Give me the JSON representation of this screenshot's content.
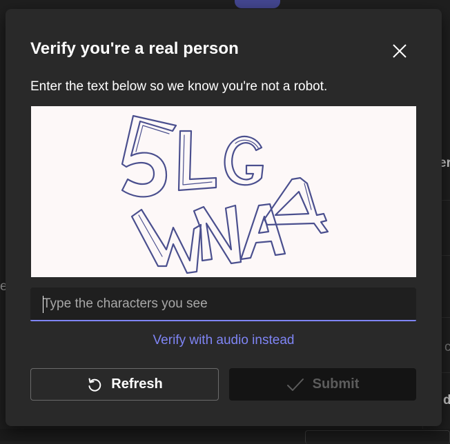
{
  "dialog": {
    "title": "Verify you're a real person",
    "subtitle": "Enter the text below so we know you're not a robot.",
    "captcha": {
      "line1": "5LG",
      "line2": "WNA",
      "stroke_color": "#4a4f8e",
      "background": "#fdf8f8"
    },
    "input": {
      "placeholder": "Type the characters you see",
      "value": ""
    },
    "audio_link": "Verify with audio instead",
    "buttons": {
      "refresh_label": "Refresh",
      "submit_label": "Submit"
    },
    "icons": {
      "close": "close-icon",
      "refresh": "refresh-icon",
      "submit": "checkmark-icon"
    }
  },
  "background": {
    "peek_1": "er",
    "peek_2": "e",
    "peek_3": "c",
    "peek_4": "d"
  },
  "colors": {
    "accent": "#7f85f5",
    "dialog_bg": "#292929",
    "page_bg": "#1f1f1f"
  }
}
